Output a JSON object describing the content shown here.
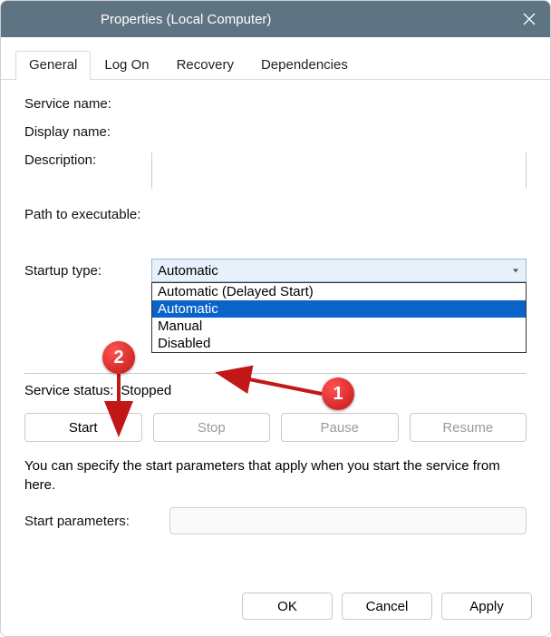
{
  "window": {
    "title": "Properties (Local Computer)"
  },
  "tabs": [
    "General",
    "Log On",
    "Recovery",
    "Dependencies"
  ],
  "labels": {
    "service_name": "Service name:",
    "display_name": "Display name:",
    "description": "Description:",
    "path": "Path to executable:",
    "startup_type": "Startup type:",
    "service_status": "Service status:",
    "status_value": "Stopped",
    "hint": "You can specify the start parameters that apply when you start the service from here.",
    "start_parameters": "Start parameters:"
  },
  "combo": {
    "selected": "Automatic",
    "options": [
      "Automatic (Delayed Start)",
      "Automatic",
      "Manual",
      "Disabled"
    ]
  },
  "buttons": {
    "start": "Start",
    "stop": "Stop",
    "pause": "Pause",
    "resume": "Resume",
    "ok": "OK",
    "cancel": "Cancel",
    "apply": "Apply"
  },
  "annotations": {
    "one": "1",
    "two": "2"
  }
}
